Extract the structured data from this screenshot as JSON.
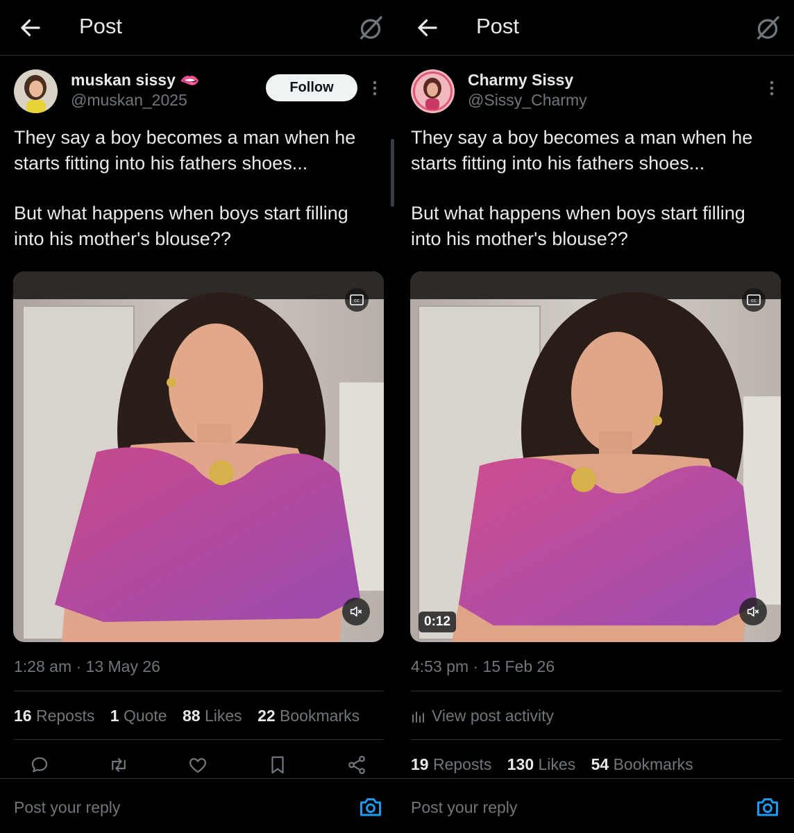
{
  "left": {
    "header": {
      "title": "Post",
      "back_icon": "arrow-left-icon",
      "grok_icon": "grok-icon"
    },
    "author": {
      "name": "muskan sissy 🫦",
      "handle": "@muskan_2025",
      "follow_label": "Follow"
    },
    "post": {
      "text_lines": [
        "They say a boy becomes a man when he",
        "starts fitting into his fathers shoes..."
      ],
      "text_lines2": [
        "But what happens when boys start filling",
        "into his mother's blouse??"
      ],
      "timestamp": "1:28 am · 13 May 26"
    },
    "stats": [
      {
        "num": "16",
        "label": "Reposts"
      },
      {
        "num": "1",
        "label": "Quote"
      },
      {
        "num": "88",
        "label": "Likes"
      },
      {
        "num": "22",
        "label": "Bookmarks"
      }
    ],
    "actions": [
      "reply-icon",
      "repost-icon",
      "like-icon",
      "bookmark-icon",
      "share-icon"
    ],
    "reply_placeholder": "Post your reply"
  },
  "right": {
    "header": {
      "title": "Post",
      "back_icon": "arrow-left-icon",
      "grok_icon": "grok-icon"
    },
    "author": {
      "name": "Charmy Sissy",
      "handle": "@Sissy_Charmy"
    },
    "post": {
      "text_lines": [
        "They say a boy becomes a man when he",
        "starts fitting into his fathers shoes..."
      ],
      "text_lines2": [
        "But what happens when boys start filling",
        "into his mother's blouse??"
      ],
      "timestamp": "4:53 pm · 15 Feb 26",
      "video_duration": "0:12"
    },
    "activity_label": "View post activity",
    "stats": [
      {
        "num": "19",
        "label": "Reposts"
      },
      {
        "num": "130",
        "label": "Likes"
      },
      {
        "num": "54",
        "label": "Bookmarks"
      }
    ],
    "reply_placeholder": "Post your reply"
  },
  "colors": {
    "background": "#000000",
    "text": "#e7e9ea",
    "muted": "#71767b",
    "divider": "#2f3336",
    "accent": "#1d9bf0"
  }
}
